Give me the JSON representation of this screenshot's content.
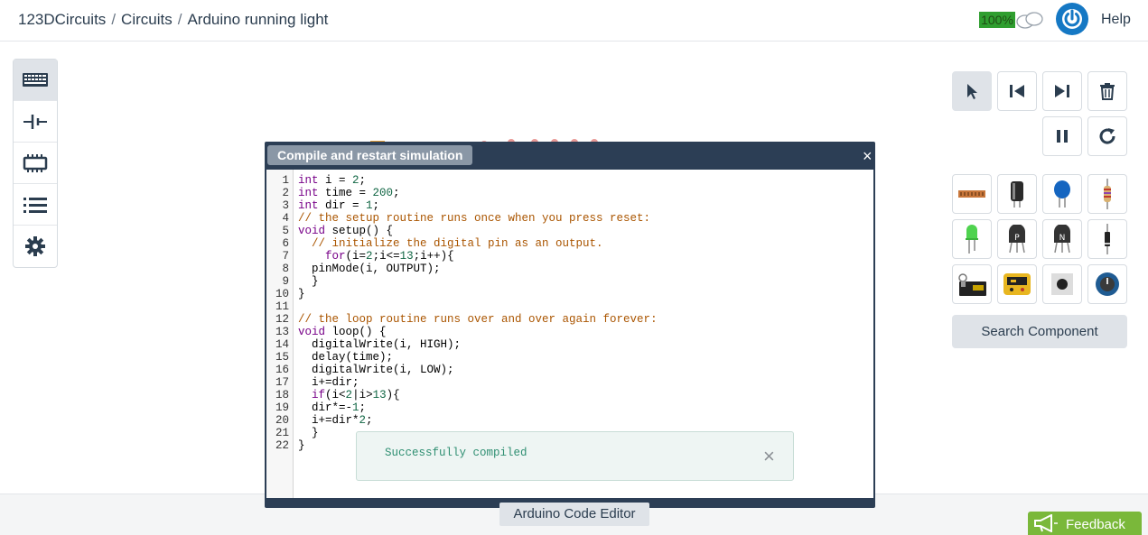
{
  "header": {
    "brand_prefix": "123D",
    "brand_suffix": "Circuits",
    "crumb_1": "Circuits",
    "crumb_2": "Arduino running light",
    "separator": "/",
    "zoom": "100%",
    "help": "Help"
  },
  "left_tools": [
    "keyboard-icon",
    "battery-icon",
    "breadboard-icon",
    "list-icon",
    "gear-icon"
  ],
  "controls": [
    "select-pointer-icon",
    "skip-back-icon",
    "skip-forward-icon",
    "trash-icon",
    "pause-icon",
    "restart-icon"
  ],
  "components": [
    "breadboard-icon",
    "capacitor-icon",
    "ceramic-capacitor-icon",
    "resistor-icon",
    "led-green-icon",
    "pnp-transistor-icon",
    "npn-transistor-icon",
    "diode-icon",
    "arduino-board-icon",
    "multimeter-icon",
    "pushbutton-icon",
    "potentiometer-icon"
  ],
  "search_component": "Search Component",
  "editor": {
    "title": "Compile and restart simulation",
    "close": "×",
    "line_numbers": [
      "1",
      "2",
      "3",
      "4",
      "5",
      "6",
      "7",
      "8",
      "9",
      "10",
      "11",
      "12",
      "13",
      "14",
      "15",
      "16",
      "17",
      "18",
      "19",
      "20",
      "21",
      "22"
    ],
    "lines": [
      [
        {
          "t": "int",
          "c": "kw"
        },
        {
          "t": " i = ",
          "c": ""
        },
        {
          "t": "2",
          "c": "num"
        },
        {
          "t": ";",
          "c": ""
        }
      ],
      [
        {
          "t": "int",
          "c": "kw"
        },
        {
          "t": " time = ",
          "c": ""
        },
        {
          "t": "200",
          "c": "num"
        },
        {
          "t": ";",
          "c": ""
        }
      ],
      [
        {
          "t": "int",
          "c": "kw"
        },
        {
          "t": " dir = ",
          "c": ""
        },
        {
          "t": "1",
          "c": "num"
        },
        {
          "t": ";",
          "c": ""
        }
      ],
      [
        {
          "t": "// the setup routine runs once when you press reset:",
          "c": "cmt"
        }
      ],
      [
        {
          "t": "void",
          "c": "kw"
        },
        {
          "t": " setup() {",
          "c": ""
        }
      ],
      [
        {
          "t": "  // initialize the digital pin as an output.",
          "c": "cmt"
        }
      ],
      [
        {
          "t": "    ",
          "c": ""
        },
        {
          "t": "for",
          "c": "kw"
        },
        {
          "t": "(i=",
          "c": ""
        },
        {
          "t": "2",
          "c": "num"
        },
        {
          "t": ";i<=",
          "c": ""
        },
        {
          "t": "13",
          "c": "num"
        },
        {
          "t": ";i++){",
          "c": ""
        }
      ],
      [
        {
          "t": "  pinMode(i, OUTPUT);",
          "c": ""
        }
      ],
      [
        {
          "t": "  }",
          "c": ""
        }
      ],
      [
        {
          "t": "}",
          "c": ""
        }
      ],
      [
        {
          "t": "",
          "c": ""
        }
      ],
      [
        {
          "t": "// the loop routine runs over and over again forever:",
          "c": "cmt"
        }
      ],
      [
        {
          "t": "void",
          "c": "kw"
        },
        {
          "t": " loop() {",
          "c": ""
        }
      ],
      [
        {
          "t": "  digitalWrite(i, HIGH);",
          "c": ""
        }
      ],
      [
        {
          "t": "  delay(time);",
          "c": ""
        }
      ],
      [
        {
          "t": "  digitalWrite(i, LOW);",
          "c": ""
        }
      ],
      [
        {
          "t": "  i+=dir;",
          "c": ""
        }
      ],
      [
        {
          "t": "  ",
          "c": ""
        },
        {
          "t": "if",
          "c": "kw"
        },
        {
          "t": "(i<",
          "c": ""
        },
        {
          "t": "2",
          "c": "num"
        },
        {
          "t": "|i>",
          "c": ""
        },
        {
          "t": "13",
          "c": "num"
        },
        {
          "t": "){",
          "c": ""
        }
      ],
      [
        {
          "t": "  dir*=-",
          "c": ""
        },
        {
          "t": "1",
          "c": "num"
        },
        {
          "t": ";",
          "c": ""
        }
      ],
      [
        {
          "t": "  i+=dir*",
          "c": ""
        },
        {
          "t": "2",
          "c": "num"
        },
        {
          "t": ";",
          "c": ""
        }
      ],
      [
        {
          "t": "  }",
          "c": ""
        }
      ],
      [
        {
          "t": "}",
          "c": ""
        }
      ]
    ]
  },
  "toast": {
    "message": "Successfully compiled",
    "close": "×"
  },
  "bottom_tab": "Arduino Code Editor",
  "feedback": "Feedback",
  "colors": {
    "accent_blue": "#1578c4",
    "zoom_green": "#2f9e2f",
    "editor_dark": "#2c3e55",
    "feedback_green": "#7ab83a"
  }
}
